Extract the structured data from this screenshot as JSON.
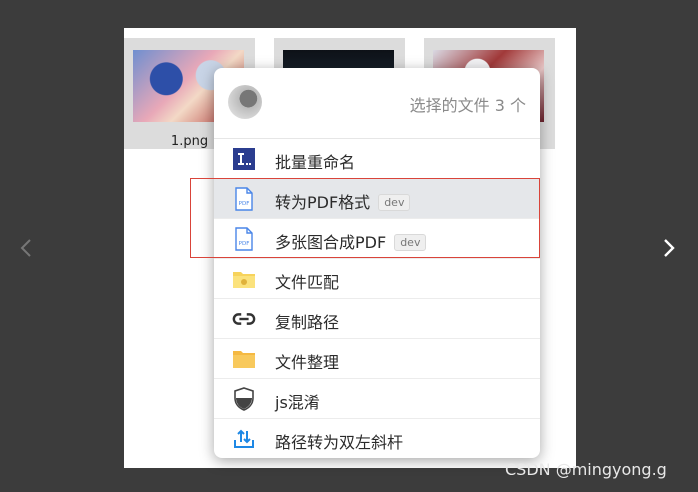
{
  "thumbnails": [
    {
      "name": "1.png"
    },
    {
      "name": ""
    },
    {
      "name": ""
    }
  ],
  "menu": {
    "header": "选择的文件 3 个",
    "items": [
      {
        "label": "批量重命名",
        "icon": "rename-icon",
        "badge": ""
      },
      {
        "label": "转为PDF格式",
        "icon": "pdf-file-icon",
        "badge": "dev",
        "highlighted": true
      },
      {
        "label": "多张图合成PDF",
        "icon": "pdf-file-icon",
        "badge": "dev"
      },
      {
        "label": "文件匹配",
        "icon": "folder-match-icon",
        "badge": ""
      },
      {
        "label": "复制路径",
        "icon": "link-icon",
        "badge": ""
      },
      {
        "label": "文件整理",
        "icon": "folder-icon",
        "badge": ""
      },
      {
        "label": "js混淆",
        "icon": "shield-icon",
        "badge": ""
      },
      {
        "label": "路径转为双左斜杆",
        "icon": "path-convert-icon",
        "badge": ""
      }
    ]
  },
  "watermark": "CSDN @mingyong.g",
  "colors": {
    "background": "#3c3c3c",
    "highlight": "#e5e7ea",
    "selection_border": "#d9443a",
    "pdf_blue": "#4a86e8"
  }
}
